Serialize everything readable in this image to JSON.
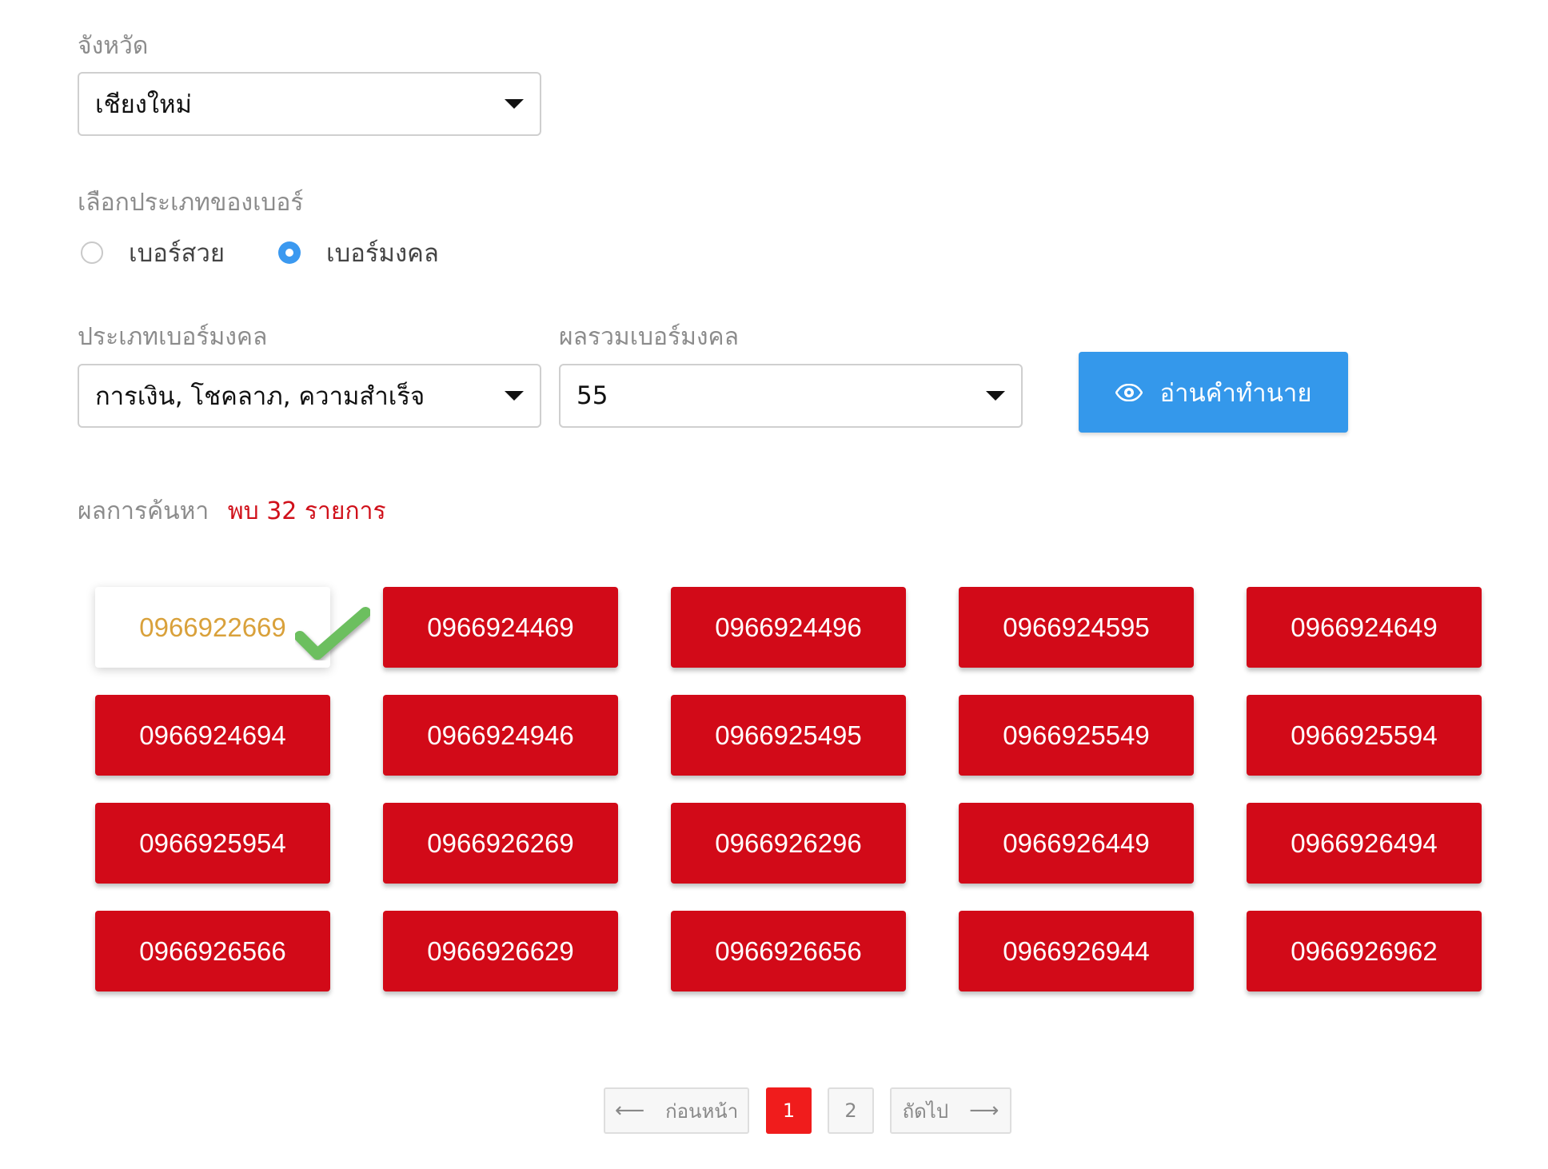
{
  "province": {
    "label": "จังหวัด",
    "selected": "เชียงใหม่"
  },
  "number_type": {
    "label": "เลือกประเภทของเบอร์",
    "options": [
      {
        "label": "เบอร์สวย",
        "checked": false
      },
      {
        "label": "เบอร์มงคล",
        "checked": true
      }
    ]
  },
  "lucky_type": {
    "label": "ประเภทเบอร์มงคล",
    "selected": "การเงิน, โชคลาภ, ความสำเร็จ"
  },
  "lucky_sum": {
    "label": "ผลรวมเบอร์มงคล",
    "selected": "55"
  },
  "predict_button": {
    "label": "อ่านคำทำนาย",
    "icon": "eye-icon",
    "color": "#3498eb"
  },
  "results": {
    "label": "ผลการค้นหา",
    "count_text": "พบ 32 รายการ",
    "accent": "#d20a18",
    "selected_color": "#d9a13b",
    "numbers": [
      {
        "value": "0966922669",
        "selected": true
      },
      {
        "value": "0966924469",
        "selected": false
      },
      {
        "value": "0966924496",
        "selected": false
      },
      {
        "value": "0966924595",
        "selected": false
      },
      {
        "value": "0966924649",
        "selected": false
      },
      {
        "value": "0966924694",
        "selected": false
      },
      {
        "value": "0966924946",
        "selected": false
      },
      {
        "value": "0966925495",
        "selected": false
      },
      {
        "value": "0966925549",
        "selected": false
      },
      {
        "value": "0966925594",
        "selected": false
      },
      {
        "value": "0966925954",
        "selected": false
      },
      {
        "value": "0966926269",
        "selected": false
      },
      {
        "value": "0966926296",
        "selected": false
      },
      {
        "value": "0966926449",
        "selected": false
      },
      {
        "value": "0966926494",
        "selected": false
      },
      {
        "value": "0966926566",
        "selected": false
      },
      {
        "value": "0966926629",
        "selected": false
      },
      {
        "value": "0966926656",
        "selected": false
      },
      {
        "value": "0966926944",
        "selected": false
      },
      {
        "value": "0966926962",
        "selected": false
      }
    ]
  },
  "pagination": {
    "prev_label": "ก่อนหน้า",
    "next_label": "ถัดไป",
    "pages": [
      "1",
      "2"
    ],
    "current_page": "1"
  }
}
